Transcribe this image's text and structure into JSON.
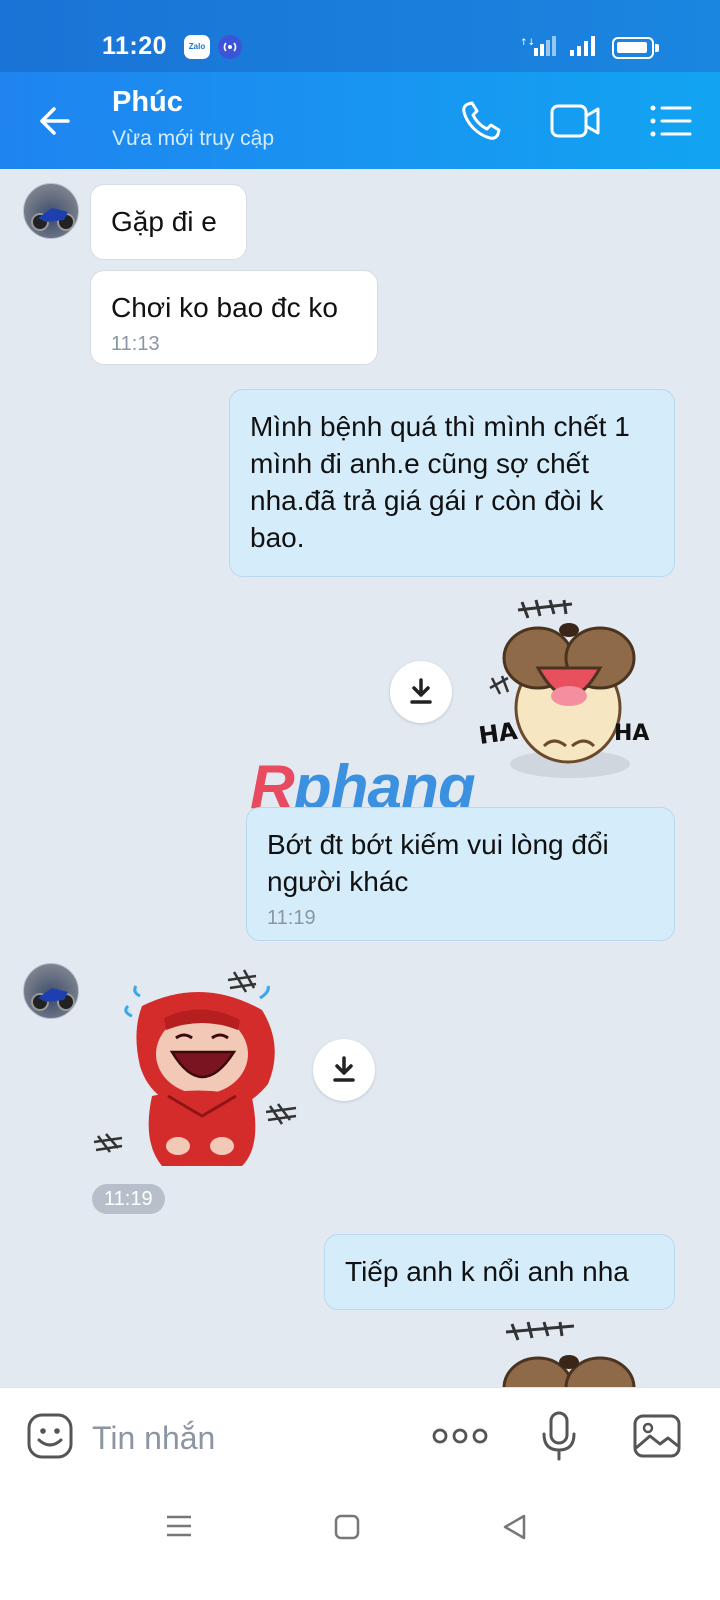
{
  "status_bar": {
    "time": "11:20",
    "zalo_badge": "Zalo"
  },
  "header": {
    "contact_name": "Phúc",
    "contact_status": "Vừa mới truy cập"
  },
  "messages": [
    {
      "side": "in",
      "text": "Gặp đi e"
    },
    {
      "side": "in",
      "text": "Chơi ko bao đc ko",
      "time": "11:13"
    },
    {
      "side": "out",
      "text": "Mình bệnh quá thì mình chết 1 mình đi anh.e cũng sợ chết nha.đã trả giá gái r còn đòi k bao."
    },
    {
      "side": "out",
      "type": "sticker",
      "sticker_label_left": "HA",
      "sticker_label_right": "HA"
    },
    {
      "side": "out",
      "text": "Bớt đt bớt kiếm vui lòng đổi người khác",
      "time": "11:19"
    },
    {
      "side": "in",
      "type": "sticker",
      "time": "11:19"
    },
    {
      "side": "out",
      "text": "Tiếp anh k nổi anh nha"
    }
  ],
  "watermark": {
    "first_letter": "R",
    "rest": "phang"
  },
  "input_bar": {
    "placeholder": "Tin nhắn"
  },
  "colors": {
    "header": "#1f84f0",
    "chat_bg": "#e2e9f1",
    "outgoing_bubble": "#d5edfb",
    "incoming_bubble": "#ffffff"
  },
  "icons": [
    "back-arrow-icon",
    "phone-icon",
    "video-camera-icon",
    "list-menu-icon",
    "download-icon",
    "emoji-icon",
    "more-dots-icon",
    "microphone-icon",
    "image-icon"
  ]
}
